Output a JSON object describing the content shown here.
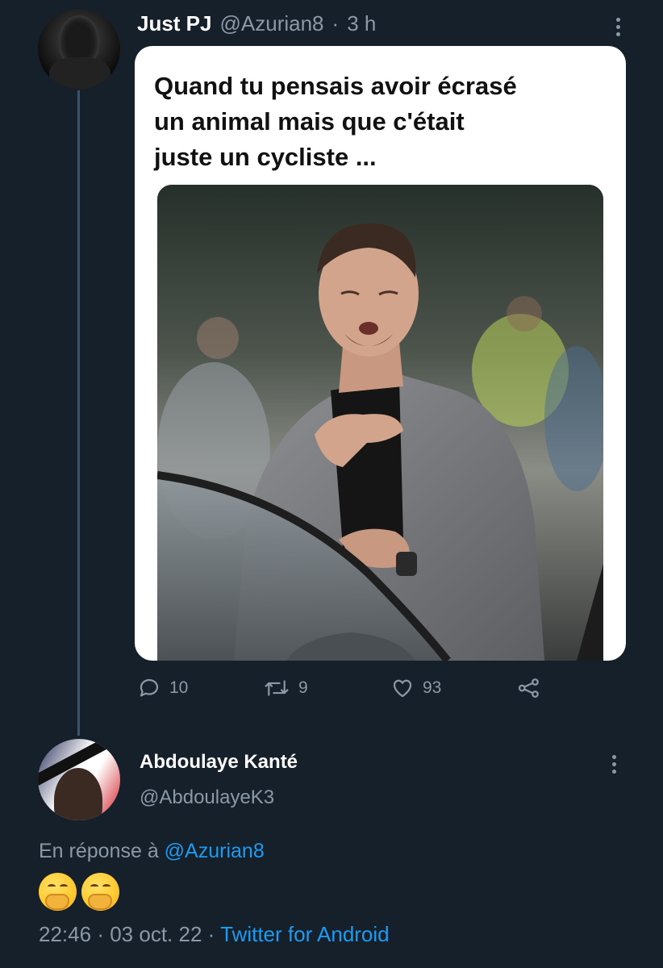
{
  "tweet": {
    "author_name": "Just PJ",
    "handle": "@Azurian8",
    "separator": "·",
    "time": "3 h",
    "meme_text": "Quand tu pensais avoir écrasé\nun animal mais que c'était\njuste un cycliste ...",
    "stats": {
      "replies": "10",
      "retweets": "9",
      "likes": "93"
    }
  },
  "reply": {
    "author_name": "Abdoulaye Kanté",
    "handle": "@AbdoulayeK3",
    "reply_prefix": "En réponse à",
    "reply_mention": "@Azurian8",
    "content_emojis": "🤭🤭",
    "timestamp": "22:46",
    "separator": "·",
    "date": "03 oct. 22",
    "separator2": "·",
    "source": "Twitter for Android"
  },
  "colors": {
    "background": "#15202b",
    "muted_text": "#8b98a5",
    "accent": "#1d9bf0"
  },
  "icons": [
    "kebab-icon",
    "reply-icon",
    "retweet-icon",
    "like-icon",
    "share-icon",
    "emoji-hand-over-mouth-icon"
  ]
}
